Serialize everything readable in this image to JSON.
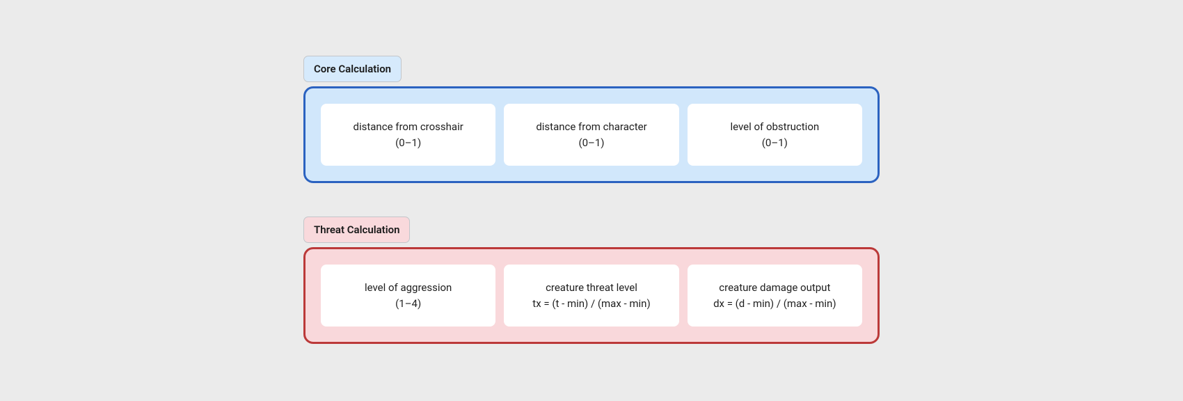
{
  "sections": [
    {
      "label": "Core Calculation",
      "theme": "blue",
      "items": [
        {
          "title": "distance from crosshair",
          "detail": "(0–1)"
        },
        {
          "title": "distance from character",
          "detail": "(0–1)"
        },
        {
          "title": "level of obstruction",
          "detail": "(0–1)"
        }
      ]
    },
    {
      "label": "Threat Calculation",
      "theme": "red",
      "items": [
        {
          "title": "level of aggression",
          "detail": "(1–4)"
        },
        {
          "title": "creature threat level",
          "detail": "tx = (t - min) / (max - min)"
        },
        {
          "title": "creature damage output",
          "detail": "dx = (d - min) / (max - min)"
        }
      ]
    }
  ]
}
